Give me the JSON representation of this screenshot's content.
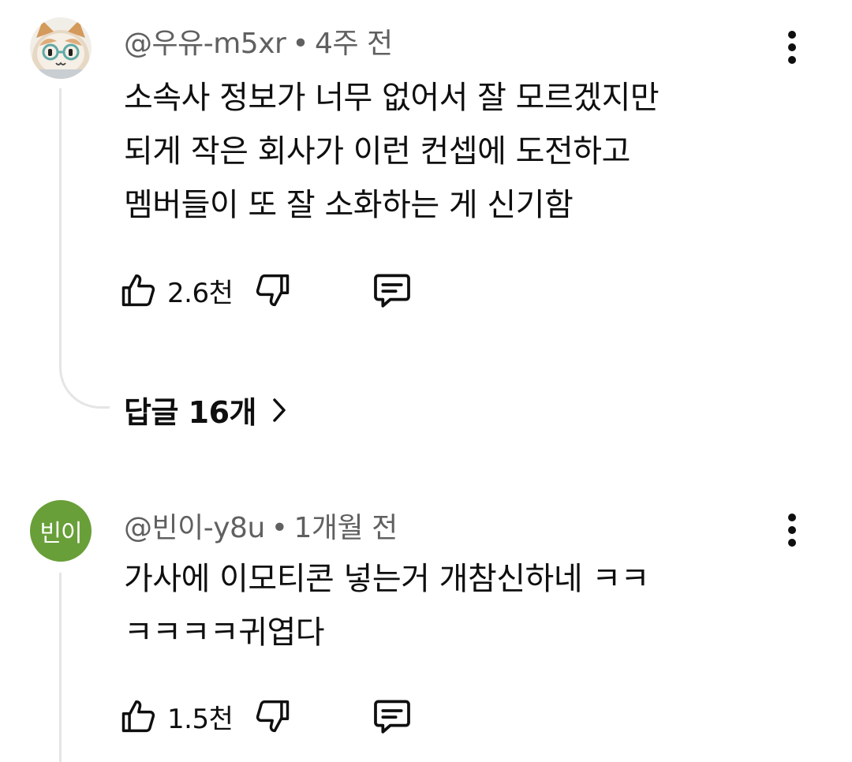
{
  "comments": [
    {
      "author": "@우유-m5xr",
      "separator": "•",
      "time": "4주 전",
      "avatar_icon": "cat-with-glasses-avatar",
      "lines": [
        "소속사 정보가 너무 없어서 잘 모르겠지만",
        "되게 작은 회사가 이런 컨셉에 도전하고",
        "멤버들이 또 잘 소화하는 게 신기함"
      ],
      "likes": "2.6천",
      "replies_label": "답글 16개"
    },
    {
      "author": "@빈이-y8u",
      "separator": "•",
      "time": "1개월 전",
      "avatar_text": "빈이",
      "avatar_color": "#689f38",
      "lines": [
        "가사에 이모티콘 넣는거 개참신하네 ㅋㅋ",
        "ㅋㅋㅋㅋ귀엽다"
      ],
      "likes": "1.5천"
    }
  ]
}
